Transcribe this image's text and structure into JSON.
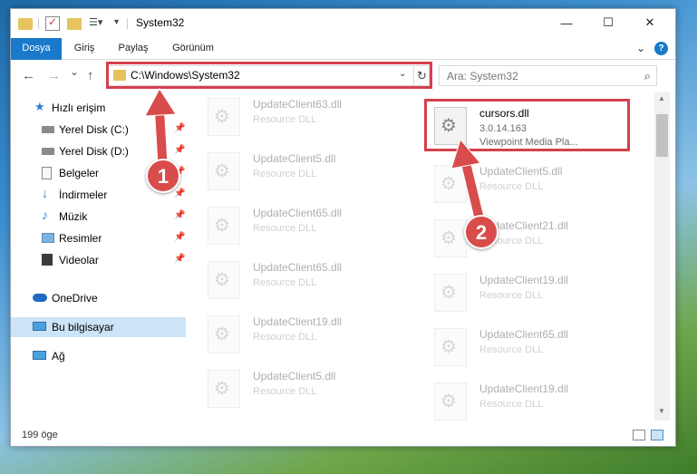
{
  "window": {
    "title": "System32",
    "controls": {
      "minimize": "—",
      "maximize": "☐",
      "close": "✕"
    }
  },
  "ribbon": {
    "tabs": [
      {
        "label": "Dosya",
        "active": true
      },
      {
        "label": "Giriş",
        "active": false
      },
      {
        "label": "Paylaş",
        "active": false
      },
      {
        "label": "Görünüm",
        "active": false
      }
    ],
    "expand_icon": "chevron-down-icon",
    "help_label": "?"
  },
  "navigation": {
    "address": "C:\\Windows\\System32",
    "search_placeholder": "Ara: System32",
    "back_icon": "←",
    "forward_icon": "→",
    "recent_icon": "⌄",
    "up_icon": "↑",
    "refresh_icon": "↻",
    "dropdown_icon": "⌄"
  },
  "sidebar": {
    "items": [
      {
        "label": "Hızlı erişim",
        "icon": "star-icon",
        "pinned": false
      },
      {
        "label": "Yerel Disk (C:)",
        "icon": "drive-icon",
        "pinned": true
      },
      {
        "label": "Yerel Disk (D:)",
        "icon": "drive-icon",
        "pinned": true
      },
      {
        "label": "Belgeler",
        "icon": "documents-icon",
        "pinned": true
      },
      {
        "label": "İndirmeler",
        "icon": "download-icon",
        "pinned": true
      },
      {
        "label": "Müzik",
        "icon": "music-icon",
        "pinned": true
      },
      {
        "label": "Resimler",
        "icon": "pictures-icon",
        "pinned": true
      },
      {
        "label": "Videolar",
        "icon": "videos-icon",
        "pinned": true
      },
      {
        "label": "OneDrive",
        "icon": "cloud-icon",
        "pinned": false
      },
      {
        "label": "Bu bilgisayar",
        "icon": "computer-icon",
        "pinned": false,
        "selected": true
      },
      {
        "label": "Ağ",
        "icon": "network-icon",
        "pinned": false
      }
    ]
  },
  "files": {
    "left_column": [
      {
        "name": "UpdateClient63.dll",
        "type": "Resource DLL"
      },
      {
        "name": "UpdateClient5.dll",
        "type": "Resource DLL"
      },
      {
        "name": "UpdateClient65.dll",
        "type": "Resource DLL"
      },
      {
        "name": "UpdateClient65.dll",
        "type": "Resource DLL"
      },
      {
        "name": "UpdateClient19.dll",
        "type": "Resource DLL"
      },
      {
        "name": "UpdateClient5.dll",
        "type": "Resource DLL"
      }
    ],
    "highlighted": {
      "name": "cursors.dll",
      "version": "3.0.14.163",
      "description": "Viewpoint Media Pla..."
    },
    "right_column": [
      {
        "name": "UpdateClient5.dll",
        "type": "Resource DLL"
      },
      {
        "name": "UpdateClient21.dll",
        "type": "Resource DLL"
      },
      {
        "name": "UpdateClient19.dll",
        "type": "Resource DLL"
      },
      {
        "name": "UpdateClient65.dll",
        "type": "Resource DLL"
      },
      {
        "name": "UpdateClient19.dll",
        "type": "Resource DLL"
      }
    ]
  },
  "status": {
    "item_count": "199 öge"
  },
  "annotations": {
    "callout_1": "1",
    "callout_2": "2",
    "highlight_color": "#d4404c",
    "callout_color": "#d84c4c"
  },
  "colors": {
    "accent": "#1979ca",
    "selection": "#cce4f7"
  }
}
